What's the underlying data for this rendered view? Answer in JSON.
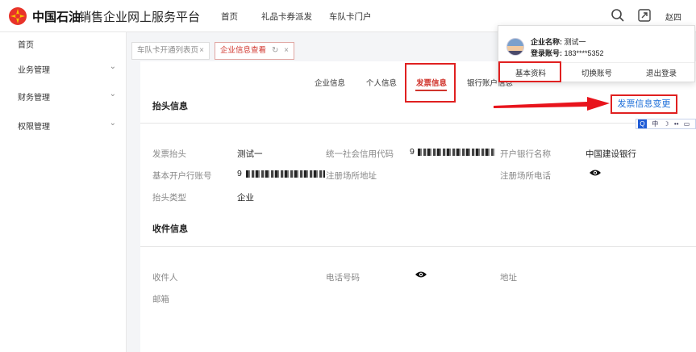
{
  "header": {
    "brand": "中国石油",
    "platform": "销售企业网上服务平台",
    "nav": [
      "首页",
      "礼品卡券派发",
      "车队卡门户"
    ],
    "username": "赵四",
    "icons": [
      "search-icon",
      "fullscreen-icon"
    ],
    "brand_color": "#d0342c"
  },
  "sidebar": {
    "items": [
      {
        "label": "首页"
      },
      {
        "label": "业务管理"
      },
      {
        "label": "财务管理"
      },
      {
        "label": "权限管理"
      }
    ]
  },
  "tabs": [
    {
      "label": "车队卡开通列表页",
      "close": "×"
    },
    {
      "label": "企业信息查看",
      "close": "×"
    }
  ],
  "subtabs": [
    "企业信息",
    "个人信息",
    "发票信息",
    "银行账户信息"
  ],
  "invoice": {
    "title": "抬头信息",
    "change_link": "发票信息变更",
    "fields": {
      "header_label": "发票抬头",
      "header_value": "测试一",
      "credit_code_label": "统一社会信用代码",
      "credit_code_prefix": "9",
      "bank_name_label": "开户银行名称",
      "bank_name_value": "中国建设银行",
      "account_label": "基本开户行账号",
      "account_prefix": "9",
      "reg_address_label": "注册场所地址",
      "reg_phone_label": "注册场所电话",
      "type_label": "抬头类型",
      "type_value": "企业"
    }
  },
  "receive": {
    "title": "收件信息",
    "recipient_label": "收件人",
    "phone_label": "电话号码",
    "address_label": "地址",
    "email_label": "邮箱"
  },
  "dropdown": {
    "company_label": "企业名称:",
    "company_value": "测试一",
    "account_label": "登录账号:",
    "account_value": "183****5352",
    "actions": [
      "基本资料",
      "切换账号",
      "退出登录"
    ]
  },
  "ime": {
    "chars": [
      "中",
      "•",
      "•"
    ]
  }
}
